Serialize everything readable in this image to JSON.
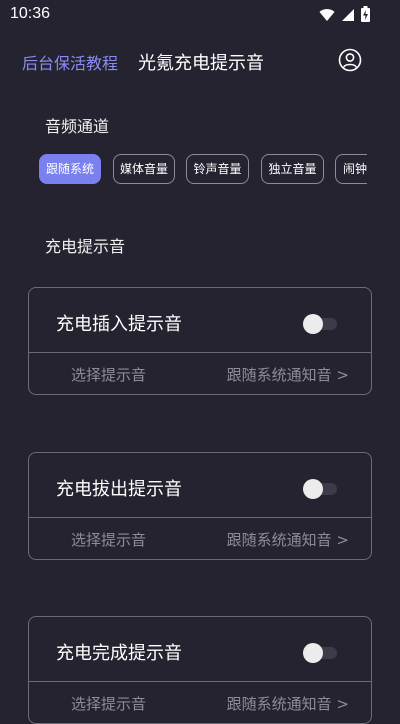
{
  "status_bar": {
    "time": "10:36",
    "icons": [
      "wifi-icon",
      "signal-icon",
      "battery-charging-icon"
    ]
  },
  "header": {
    "link_label": "后台保活教程",
    "title": "光氪充电提示音",
    "avatar_icon": "user-circle-icon",
    "accent_color": "#8a8cf3"
  },
  "audio_channel": {
    "label": "音频通道",
    "options": [
      "跟随系统",
      "媒体音量",
      "铃声音量",
      "独立音量",
      "闹钟"
    ],
    "selected": "跟随系统"
  },
  "charge_sound": {
    "label": "充电提示音",
    "cards": [
      {
        "title": "充电插入提示音",
        "enabled": false,
        "select_label": "选择提示音",
        "select_value": "跟随系统通知音 >"
      },
      {
        "title": "充电拔出提示音",
        "enabled": false,
        "select_label": "选择提示音",
        "select_value": "跟随系统通知音 >"
      },
      {
        "title": "充电完成提示音",
        "enabled": false,
        "select_label": "选择提示音",
        "select_value": "跟随系统通知音 >"
      }
    ]
  }
}
